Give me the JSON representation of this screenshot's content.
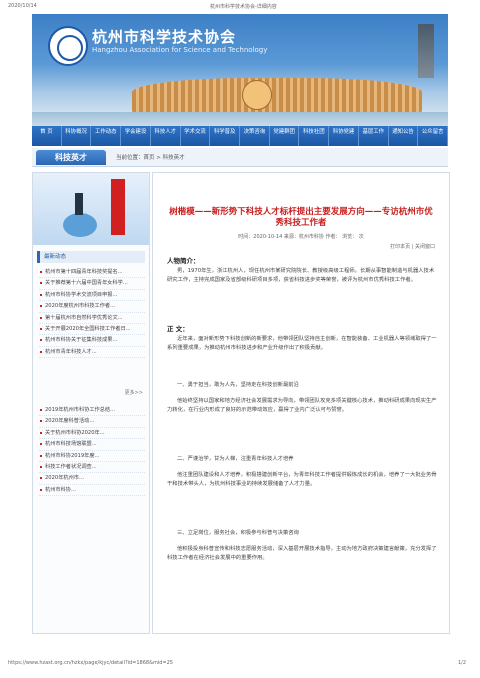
{
  "print_header": {
    "date": "2020/10/14",
    "title": "杭州市科学技术协会-详细内容"
  },
  "site": {
    "name_cn": "杭州市科学技术协会",
    "name_en": "Hangzhou Association for Science and Technology"
  },
  "nav": {
    "items": [
      "首 页",
      "科协概况",
      "工作动态",
      "学会建设",
      "科技人才",
      "学术交流",
      "科学普及",
      "决策咨询",
      "党建群团",
      "科技社团",
      "科协党建",
      "基层工作",
      "通知公告",
      "公众留言"
    ]
  },
  "section_tab": "科技英才",
  "breadcrumb": "当前位置：首页 > 科技英才",
  "sidebar": {
    "box_title": "最新动态",
    "items_a": [
      "杭州市第十四届青年科技奖提名...",
      "关于推荐第十六届中国青年女科学...",
      "杭州市科协学术交流项目申报...",
      "2020年度杭州市科技工作者...",
      "第十届杭州市自然科学优秀论文...",
      "关于开展2020年全国科技工作者日...",
      "杭州市科协关于征集科技成果...",
      "杭州市青年科技人才..."
    ],
    "more_label": "更多>>",
    "items_b": [
      "2019年杭州市科协工作总结...",
      "2020年度科普活动...",
      "关于杭州市科协2020年...",
      "杭州市科技场馆联盟...",
      "杭州市科协2019年度...",
      "科技工作者状况调查...",
      "2020年杭州市...",
      "杭州市科协..."
    ]
  },
  "article": {
    "title": "树楷模——新形势下科技人才标杆提出主要发展方向——专访杭州市优秀科技工作者",
    "meta": "时间：2020-10-14  来源：杭州市科协  作者：  浏览：  次",
    "print_label": "打印本页 | 关闭窗口",
    "intro_heading": "人物简介：",
    "intro": "男，1970年生，浙江杭州人，现任杭州市某研究院院长、教授级高级工程师。长期从事智能制造与机器人技术研究工作，主持完成国家及省部级科研项目多项，获省科技进步奖等荣誉，被评为杭州市优秀科技工作者。",
    "body_heading": "正 文：",
    "paragraphs": [
      "近年来，面对新形势下科技创新的新要求，他带领团队坚持自主创新，在智能装备、工业机器人等领域取得了一系列重要成果，为推动杭州市科技进步和产业升级作出了积极贡献。",
      "一、勇于担当，敢为人先，坚持走在科技创新最前沿",
      "他始终坚持以国家和地方经济社会发展需求为导向，带领团队攻克多项关键核心技术，推动科研成果向现实生产力转化，在行业内形成了良好的示范带动效应，赢得了业内广泛认可与赞誉。",
      "二、严谨治学，甘为人梯，注重青年科技人才培养",
      "他注重团队建设和人才培养，积极搭建创新平台，为青年科技工作者提供锻炼成长的机会，培养了一大批业务骨干和技术带头人，为杭州科技事业的持续发展储备了人才力量。",
      "三、立足岗位，服务社会，积极参与科普与决策咨询",
      "他积极投身科普宣传和科技志愿服务活动，深入基层开展技术指导，主动为地方政府决策建言献策，充分发挥了科技工作者在经济社会发展中的重要作用。"
    ]
  },
  "footer": {
    "url": "https://www.hzast.org.cn/hzkx/page/kjyc/detail?id=1868&mid=25",
    "page": "1/2"
  }
}
